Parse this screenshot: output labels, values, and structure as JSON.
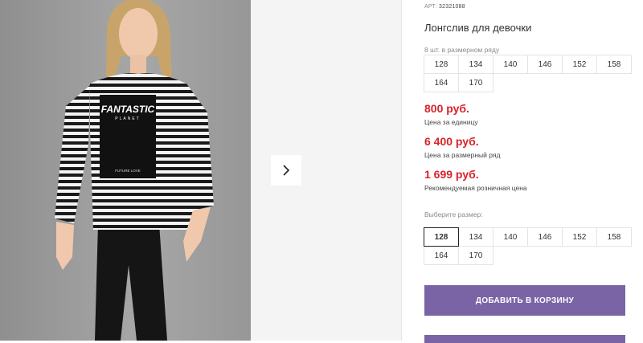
{
  "gallery": {
    "photo_print_title": "FANTASTIC",
    "photo_print_subtitle": "PLANET",
    "photo_print_tagline": "FUTURE LOVE"
  },
  "product": {
    "article_label": "АРТ:",
    "article_number": "32321088",
    "title": "Лонгслив для девочки",
    "pack_caption": "8 шт. в размерном ряду",
    "pack_sizes": [
      "128",
      "134",
      "140",
      "146",
      "152",
      "158",
      "164",
      "170"
    ],
    "prices": [
      {
        "value": "800 руб.",
        "note": "Цена за единицу"
      },
      {
        "value": "6 400 руб.",
        "note": "Цена за размерный ряд"
      },
      {
        "value": "1 699 руб.",
        "note": "Рекомендуемая розничная цена"
      }
    ],
    "choose_size_caption": "Выберите размер:",
    "choose_sizes": [
      "128",
      "134",
      "140",
      "146",
      "152",
      "158",
      "164",
      "170"
    ],
    "selected_size": "128",
    "add_to_cart_label": "ДОБАВИТЬ В КОРЗИНУ"
  },
  "colors": {
    "price_red": "#d8232a",
    "button_purple": "#7a64a6"
  }
}
